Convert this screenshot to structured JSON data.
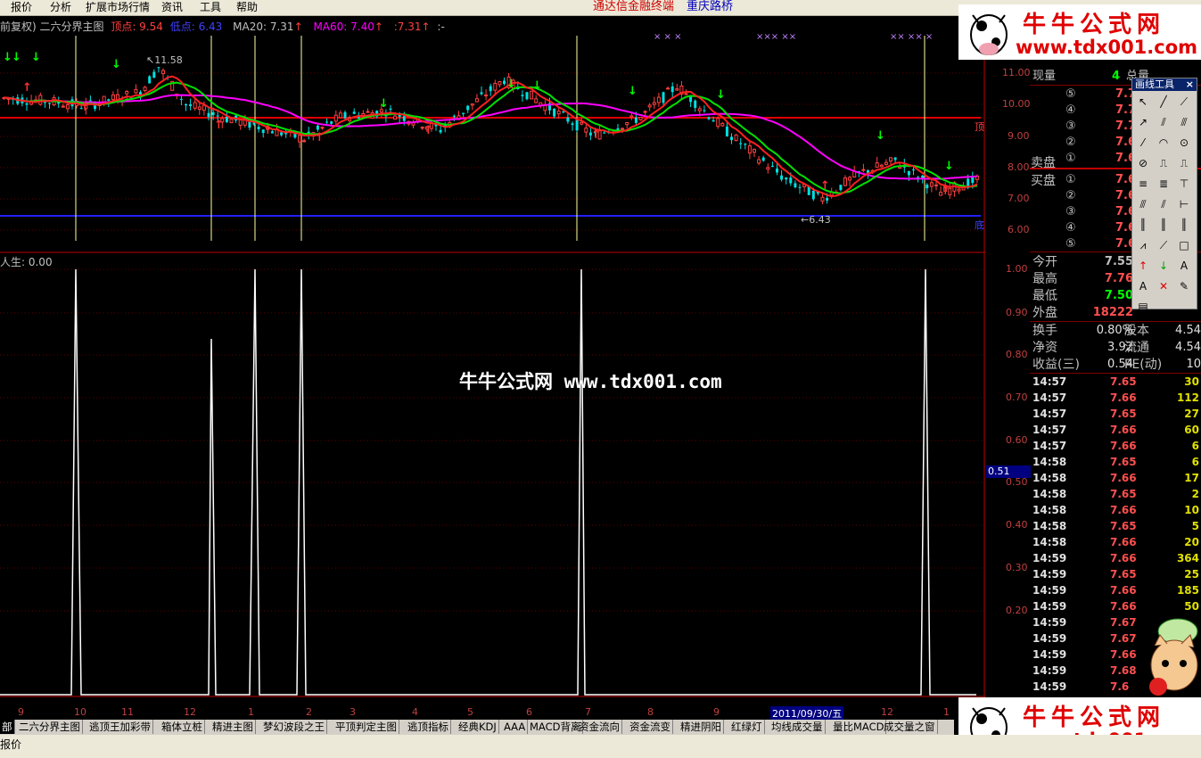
{
  "menu": [
    "报价",
    "分析",
    "扩展市场行情",
    "资讯",
    "工具",
    "帮助"
  ],
  "ad": {
    "text1": "通达信金融终端",
    "text2": "重庆路桥"
  },
  "header": {
    "prefix": "前复权) 二六分界主图",
    "top_label": "顶点: 9.54",
    "bottom_label": "低点: 6.43",
    "ma20": "MA20: 7.31",
    "ma60": "MA60: 7.40",
    "extra": ":7.31",
    "extra2": ":-"
  },
  "price_axis": [
    "11.00",
    "10.00",
    "9.00",
    "8.00",
    "7.00",
    "6.00"
  ],
  "price_marks": {
    "high": "11.58",
    "low": "6.43",
    "top_tag": "顶",
    "bottom_tag": "底"
  },
  "indicator": {
    "title": "人生: 0.00",
    "axis": [
      "1.00",
      "0.90",
      "0.80",
      "0.70",
      "0.60",
      "0.50",
      "0.40",
      "0.30",
      "0.20"
    ],
    "cursor_value": "0.51"
  },
  "date_axis": [
    "9",
    "10",
    "11",
    "12",
    "1",
    "2",
    "3",
    "4",
    "5",
    "6",
    "7",
    "8",
    "9",
    "2011/09/30/五",
    "12",
    "1"
  ],
  "right_panel": {
    "xianliang_label": "现量",
    "xianliang_value": "4",
    "zongliang_label": "总量",
    "sell": [
      {
        "lv": "⑤",
        "p": "7.7"
      },
      {
        "lv": "④",
        "p": "7.7"
      },
      {
        "lv": "③",
        "p": "7.7"
      },
      {
        "lv": "②",
        "p": "7.6"
      },
      {
        "lv": "①",
        "p": "7.6"
      }
    ],
    "sell_label": "卖盘",
    "buy_label": "买盘",
    "buy": [
      {
        "lv": "①",
        "p": "7.6"
      },
      {
        "lv": "②",
        "p": "7.6"
      },
      {
        "lv": "③",
        "p": "7.6"
      },
      {
        "lv": "④",
        "p": "7.6"
      },
      {
        "lv": "⑤",
        "p": "7.6"
      }
    ],
    "stats": [
      {
        "l": "今开",
        "v": "7.55"
      },
      {
        "l": "最高",
        "v": "7.76"
      },
      {
        "l": "最低",
        "v": "7.50"
      },
      {
        "l": "外盘",
        "v": "18222"
      }
    ],
    "stats2": [
      {
        "l": "换手",
        "v": "0.80%",
        "l2": "股本",
        "v2": "4.54"
      },
      {
        "l": "净资",
        "v": "3.92",
        "l2": "流通",
        "v2": "4.54"
      },
      {
        "l": "收益(三)",
        "v": "0.54",
        "l2": "PE(动)",
        "v2": "10"
      }
    ],
    "ticks": [
      {
        "t": "14:57",
        "p": "7.65",
        "v": "30"
      },
      {
        "t": "14:57",
        "p": "7.66",
        "v": "112"
      },
      {
        "t": "14:57",
        "p": "7.65",
        "v": "27"
      },
      {
        "t": "14:57",
        "p": "7.66",
        "v": "60"
      },
      {
        "t": "14:57",
        "p": "7.66",
        "v": "6"
      },
      {
        "t": "14:58",
        "p": "7.65",
        "v": "6"
      },
      {
        "t": "14:58",
        "p": "7.66",
        "v": "17"
      },
      {
        "t": "14:58",
        "p": "7.65",
        "v": "2"
      },
      {
        "t": "14:58",
        "p": "7.66",
        "v": "10"
      },
      {
        "t": "14:58",
        "p": "7.65",
        "v": "5"
      },
      {
        "t": "14:58",
        "p": "7.66",
        "v": "20"
      },
      {
        "t": "14:59",
        "p": "7.66",
        "v": "364"
      },
      {
        "t": "14:59",
        "p": "7.65",
        "v": "25"
      },
      {
        "t": "14:59",
        "p": "7.66",
        "v": "185"
      },
      {
        "t": "14:59",
        "p": "7.66",
        "v": "50"
      },
      {
        "t": "14:59",
        "p": "7.67",
        "v": ""
      },
      {
        "t": "14:59",
        "p": "7.67",
        "v": ""
      },
      {
        "t": "14:59",
        "p": "7.66",
        "v": ""
      },
      {
        "t": "14:59",
        "p": "7.68",
        "v": ""
      },
      {
        "t": "14:59",
        "p": "7.6",
        "v": ""
      }
    ]
  },
  "toolbox": {
    "title": "画线工具",
    "close": "×"
  },
  "watermark": "牛牛公式网 www.tdx001.com",
  "logo": {
    "cn": "牛牛公式网",
    "url": "www.tdx001.com"
  },
  "tabs": [
    "部",
    "二六分界主图",
    "逃顶王加彩带",
    "箱体立桩",
    "精进主图",
    "梦幻波段之王",
    "平顶判定主图",
    "逃顶指标",
    "经典KDJ",
    "AAA",
    "MACD背离",
    "资金流向",
    "资金流变",
    "精进阴阳",
    "红绿灯",
    "均线成交量",
    "量比MACD",
    "成交量之窗"
  ],
  "status": {
    "quote": "报价"
  },
  "colors": {
    "up": "#ff4040",
    "down": "#00e0e0",
    "ma20": "#00ff00",
    "ma60": "#ff00ff",
    "ma_short": "#ff2020",
    "top_line": "#e00000",
    "bottom_line": "#2020ff",
    "signal": "#ffffa0"
  }
}
